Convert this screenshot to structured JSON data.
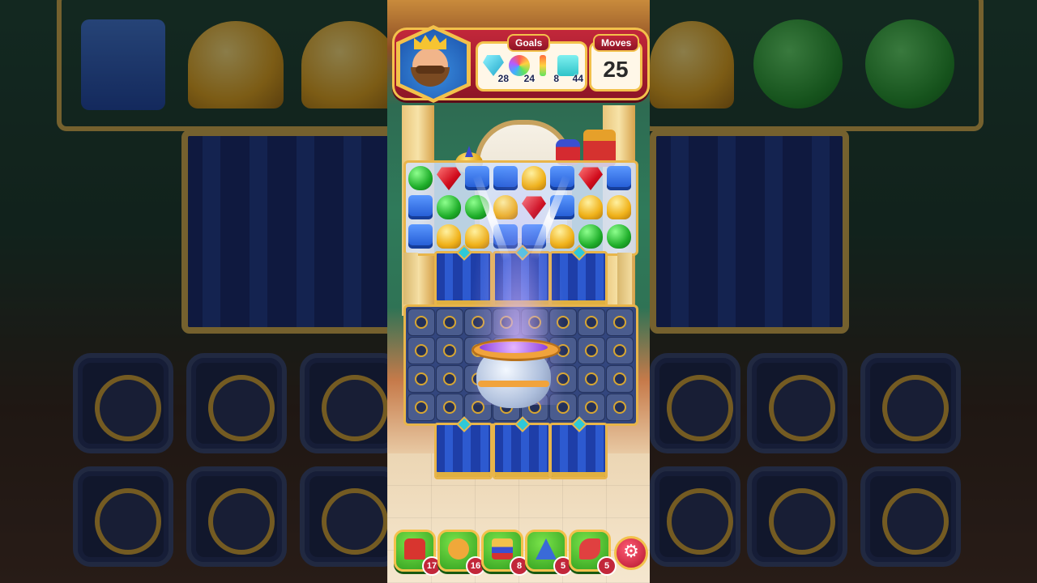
{
  "hud": {
    "goals_label": "Goals",
    "moves_label": "Moves",
    "moves": "25",
    "goals": [
      {
        "icon": "diamond-icon",
        "count": "28"
      },
      {
        "icon": "rainbow-orb-icon",
        "count": "24"
      },
      {
        "icon": "color-bar-icon",
        "count": "8"
      },
      {
        "icon": "cyan-tile-icon",
        "count": "44"
      }
    ]
  },
  "board": {
    "rows": [
      [
        "green",
        "red",
        "blue",
        "blue",
        "gold",
        "blue",
        "red",
        "blue"
      ],
      [
        "blue",
        "green",
        "green",
        "gold",
        "red",
        "blue",
        "gold",
        "gold"
      ],
      [
        "blue",
        "gold",
        "gold",
        "blue",
        "blue",
        "gold",
        "green",
        "green"
      ]
    ]
  },
  "boosters": [
    {
      "icon": "mailbox-icon",
      "count": "17"
    },
    {
      "icon": "hand-icon",
      "count": "16"
    },
    {
      "icon": "cake-icon",
      "count": "8"
    },
    {
      "icon": "wizard-hat-icon",
      "count": "5"
    },
    {
      "icon": "rocket-icon",
      "count": "5"
    }
  ],
  "settings_icon": "gear-icon",
  "colors": {
    "accent": "#c2273a",
    "gold": "#f3c14b",
    "board": "#33467e"
  }
}
